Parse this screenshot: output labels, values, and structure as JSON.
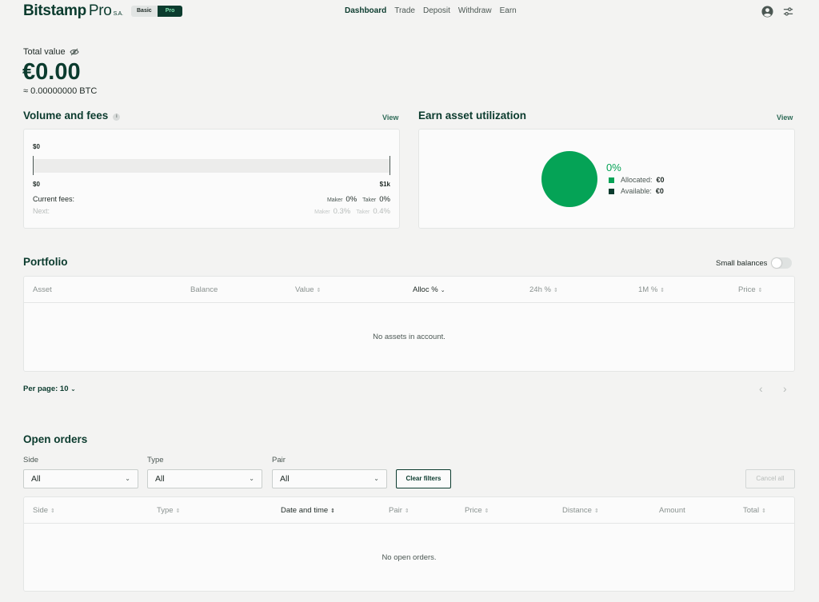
{
  "header": {
    "brand": "Bitstamp",
    "brand_pro": "Pro",
    "brand_suffix": "S.A.",
    "mode_basic": "Basic",
    "mode_pro": "Pro",
    "nav": [
      "Dashboard",
      "Trade",
      "Deposit",
      "Withdraw",
      "Earn"
    ],
    "active_nav": "Dashboard",
    "icons": [
      "account-icon",
      "settings-sliders-icon"
    ]
  },
  "total": {
    "label": "Total value",
    "amount": "€0.00",
    "btc": "≈ 0.00000000 BTC"
  },
  "volume": {
    "title": "Volume and fees",
    "view": "View",
    "current_volume": "$0",
    "min": "$0",
    "max": "$1k",
    "progress": 0,
    "current_fees_label": "Current fees:",
    "next_label": "Next:",
    "maker_label": "Maker",
    "taker_label": "Taker",
    "current_maker": "0%",
    "current_taker": "0%",
    "next_maker": "0.3%",
    "next_taker": "0.4%"
  },
  "earn": {
    "title": "Earn asset utilization",
    "view": "View",
    "percent": "0%",
    "allocated_label": "Allocated:",
    "allocated_value": "€0",
    "available_label": "Available:",
    "available_value": "€0",
    "colors": {
      "allocated": "#05a356",
      "available": "#0b3b2e"
    }
  },
  "portfolio": {
    "title": "Portfolio",
    "small_balances": "Small balances",
    "small_balances_on": false,
    "columns": [
      "Asset",
      "Balance",
      "Value",
      "Alloc %",
      "24h %",
      "1M %",
      "Price"
    ],
    "sorted_column": "Alloc %",
    "empty": "No assets in account.",
    "per_page_label": "Per page: 10"
  },
  "orders": {
    "title": "Open orders",
    "side_label": "Side",
    "type_label": "Type",
    "pair_label": "Pair",
    "side_value": "All",
    "type_value": "All",
    "pair_value": "All",
    "clear_filters": "Clear filters",
    "cancel_all": "Cancel all",
    "columns": [
      "Side",
      "Type",
      "Date and time",
      "Pair",
      "Price",
      "Distance",
      "Amount",
      "Total"
    ],
    "sorted_column": "Date and time",
    "empty": "No open orders."
  }
}
